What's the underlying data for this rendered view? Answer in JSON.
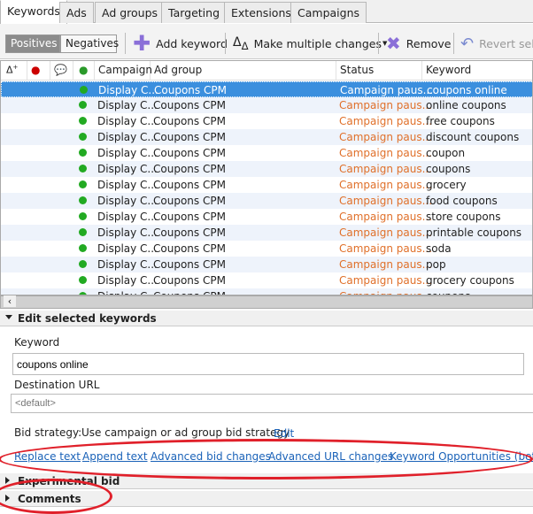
{
  "tabs": [
    "Keywords",
    "Ads",
    "Ad groups",
    "Targeting",
    "Extensions",
    "Campaigns"
  ],
  "toolbar": {
    "positives": "Positives",
    "negatives": "Negatives",
    "add_keyword": "Add keyword",
    "make_multiple": "Make multiple changes",
    "remove": "Remove",
    "revert": "Revert sele"
  },
  "grid": {
    "columns": [
      "Campaign",
      "Ad group",
      "Status",
      "Keyword"
    ],
    "header_icons": [
      "add-change-icon",
      "error-icon",
      "comment-icon",
      "status-icon"
    ],
    "rows": [
      {
        "campaign": "Display C...",
        "adgroup": "Coupons CPM",
        "status": "Campaign paus...",
        "keyword": "coupons online"
      },
      {
        "campaign": "Display C...",
        "adgroup": "Coupons CPM",
        "status": "Campaign paus...",
        "keyword": "online coupons"
      },
      {
        "campaign": "Display C...",
        "adgroup": "Coupons CPM",
        "status": "Campaign paus...",
        "keyword": "free coupons"
      },
      {
        "campaign": "Display C...",
        "adgroup": "Coupons CPM",
        "status": "Campaign paus...",
        "keyword": "discount coupons"
      },
      {
        "campaign": "Display C...",
        "adgroup": "Coupons CPM",
        "status": "Campaign paus...",
        "keyword": "coupon"
      },
      {
        "campaign": "Display C...",
        "adgroup": "Coupons CPM",
        "status": "Campaign paus...",
        "keyword": "coupons"
      },
      {
        "campaign": "Display C...",
        "adgroup": "Coupons CPM",
        "status": "Campaign paus...",
        "keyword": "grocery"
      },
      {
        "campaign": "Display C...",
        "adgroup": "Coupons CPM",
        "status": "Campaign paus...",
        "keyword": "food coupons"
      },
      {
        "campaign": "Display C...",
        "adgroup": "Coupons CPM",
        "status": "Campaign paus...",
        "keyword": "store coupons"
      },
      {
        "campaign": "Display C...",
        "adgroup": "Coupons CPM",
        "status": "Campaign paus...",
        "keyword": "printable coupons"
      },
      {
        "campaign": "Display C...",
        "adgroup": "Coupons CPM",
        "status": "Campaign paus...",
        "keyword": "soda"
      },
      {
        "campaign": "Display C...",
        "adgroup": "Coupons CPM",
        "status": "Campaign paus...",
        "keyword": "pop"
      },
      {
        "campaign": "Display C...",
        "adgroup": "Coupons CPM",
        "status": "Campaign paus...",
        "keyword": "grocery coupons"
      },
      {
        "campaign": "Display C...",
        "adgroup": "Coupons CPM",
        "status": "Campaign paus...",
        "keyword": "coupons"
      }
    ]
  },
  "edit": {
    "title": "Edit selected keywords",
    "keyword_label": "Keyword",
    "keyword_value": "coupons online",
    "dest_label": "Destination URL",
    "dest_placeholder": "<default>",
    "bid_label": "Bid strategy:",
    "bid_value": "Use campaign or ad group bid strategy",
    "bid_edit": "Edit",
    "links": [
      "Replace text",
      "Append text",
      "Advanced bid changes",
      "Advanced URL changes",
      "Keyword Opportunities (beta)"
    ]
  },
  "sections": {
    "experimental": "Experimental bid",
    "comments": "Comments"
  },
  "colors": {
    "selected_row": "#3b8fde",
    "status_paused": "#e0702a",
    "annotation": "#e0202a"
  }
}
